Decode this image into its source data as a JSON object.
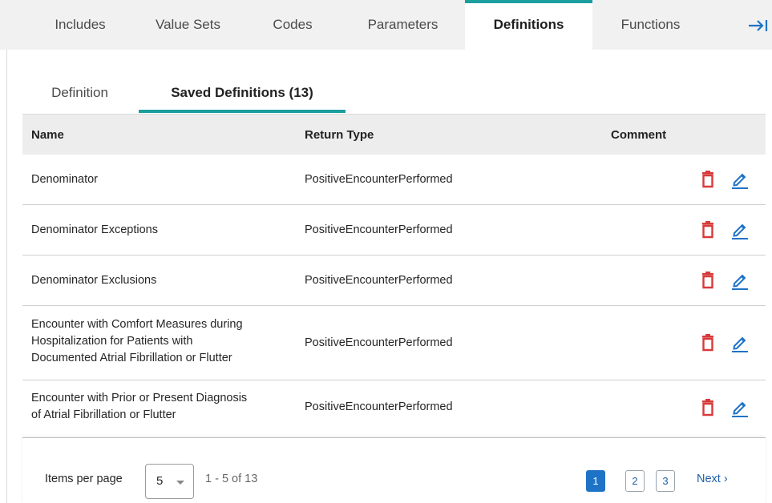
{
  "top_tabs": [
    {
      "label": "Includes"
    },
    {
      "label": "Value Sets"
    },
    {
      "label": "Codes"
    },
    {
      "label": "Parameters"
    },
    {
      "label": "Definitions",
      "active": true
    },
    {
      "label": "Functions"
    }
  ],
  "top_tabs_collapse_icon": "arrow-right-to-bar-icon",
  "sub_tabs": [
    {
      "label": "Definition"
    },
    {
      "label": "Saved Definitions (13)",
      "active": true
    }
  ],
  "table": {
    "headers": {
      "name": "Name",
      "return_type": "Return Type",
      "comment": "Comment"
    },
    "rows": [
      {
        "name": [
          "Denominator"
        ],
        "return_type": "PositiveEncounterPerformed"
      },
      {
        "name": [
          "Denominator Exceptions"
        ],
        "return_type": "PositiveEncounterPerformed"
      },
      {
        "name": [
          "Denominator Exclusions"
        ],
        "return_type": "PositiveEncounterPerformed"
      },
      {
        "name": [
          "Encounter with Comfort Measures during",
          "Hospitalization for Patients with",
          "Documented Atrial Fibrillation or Flutter"
        ],
        "return_type": "PositiveEncounterPerformed"
      },
      {
        "name": [
          "Encounter with Prior or Present Diagnosis",
          "of Atrial Fibrillation or Flutter"
        ],
        "return_type": "PositiveEncounterPerformed"
      }
    ],
    "row_actions": {
      "delete_icon": "trash-icon",
      "edit_icon": "pencil-icon"
    }
  },
  "pagination": {
    "items_per_page_label": "Items per page",
    "items_per_page_value": "5",
    "range_text": "1 - 5 of 13",
    "pages": [
      "1",
      "2",
      "3"
    ],
    "current_page": "1",
    "next_label": "Next ›"
  },
  "colors": {
    "accent_teal": "#1a9e9e",
    "delete_red": "#d83a3a",
    "edit_blue": "#1f73c6",
    "header_bg": "#ededed",
    "tabbar_bg": "#f1f1f1"
  }
}
